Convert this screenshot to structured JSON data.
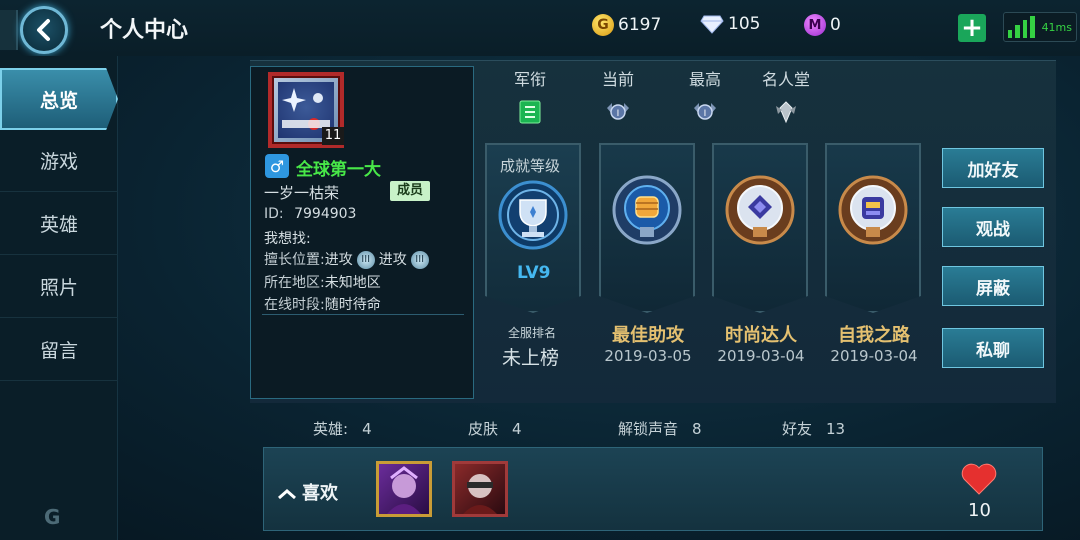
{
  "header": {
    "title": "个人中心",
    "gold": "6197",
    "diamonds": "105",
    "m_coins": "0",
    "ping": "41ms"
  },
  "sidebar": {
    "items": [
      {
        "label": "总览"
      },
      {
        "label": "游戏"
      },
      {
        "label": "英雄"
      },
      {
        "label": "照片"
      },
      {
        "label": "留言"
      }
    ]
  },
  "profile": {
    "avatar_level": "11",
    "nickname": "全球第一大",
    "name": "一岁一枯荣",
    "member_badge": "成员",
    "id_label": "ID:",
    "id_value": "7994903",
    "seeking_label": "我想找:",
    "position_label": "擅长位置:",
    "position_1": "进攻",
    "position_2": "进攻",
    "region_label": "所在地区:",
    "region_value": "未知地区",
    "online_label": "在线时段:",
    "online_value": "随时待命"
  },
  "ranks": {
    "headers": [
      "军衔",
      "当前",
      "最高",
      "名人堂"
    ]
  },
  "badges": {
    "achievement_level_title": "成就等级",
    "achievement_level": "LV9",
    "server_rank_label": "全服排名",
    "server_rank_value": "未上榜",
    "achievements": [
      {
        "name": "最佳助攻",
        "date": "2019-03-05"
      },
      {
        "name": "时尚达人",
        "date": "2019-03-04"
      },
      {
        "name": "自我之路",
        "date": "2019-03-04"
      }
    ]
  },
  "actions": {
    "add_friend": "加好友",
    "spectate": "观战",
    "block": "屏蔽",
    "private_chat": "私聊"
  },
  "stats": {
    "heroes_label": "英雄:",
    "heroes_value": "4",
    "skins_label": "皮肤",
    "skins_value": "4",
    "voices_label": "解锁声音",
    "voices_value": "8",
    "friends_label": "好友",
    "friends_value": "13"
  },
  "likes": {
    "label": "喜欢",
    "count": "10"
  },
  "colors": {
    "accent": "#6fc6e0",
    "nickname": "#48e848",
    "achievement": "#e4c070",
    "signal": "#35d143"
  }
}
